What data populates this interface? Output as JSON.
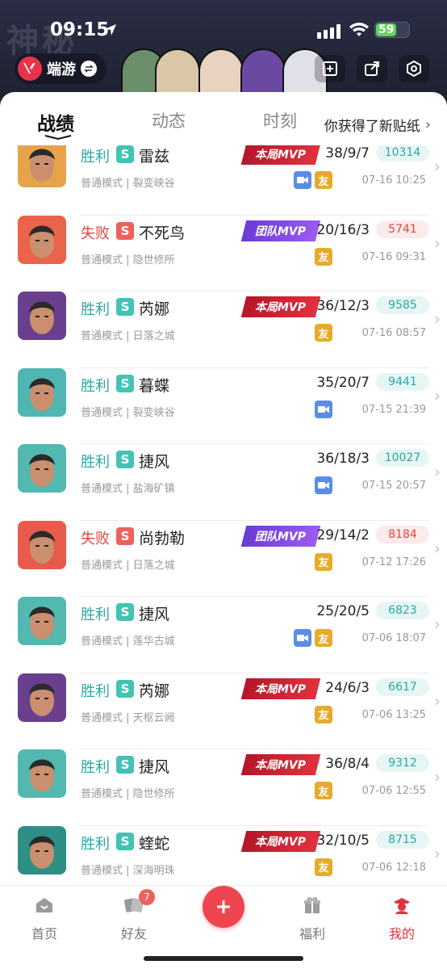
{
  "status_bar": {
    "time": "09:15",
    "battery": "59"
  },
  "header": {
    "app_name": "端游"
  },
  "tabs": [
    {
      "label": "战绩",
      "active": true
    },
    {
      "label": "动态",
      "active": false
    },
    {
      "label": "时刻",
      "active": false
    }
  ],
  "notice": "你获得了新贴纸",
  "records": [
    {
      "result": "胜利",
      "outcome": "win",
      "rank": "S",
      "hero": "雷兹",
      "mode": "普通模式 | 裂变峡谷",
      "mvp": "本局MVP",
      "mvp_type": "match",
      "kda": "38/9/7",
      "score": "10314",
      "video": true,
      "friend": true,
      "datetime": "07-16 10:25",
      "avatar_bg": "#e7a34a"
    },
    {
      "result": "失败",
      "outcome": "lose",
      "rank": "S",
      "hero": "不死鸟",
      "mode": "普通模式 | 隐世修所",
      "mvp": "团队MVP",
      "mvp_type": "team",
      "kda": "20/16/3",
      "score": "5741",
      "video": false,
      "friend": true,
      "datetime": "07-16 09:31",
      "avatar_bg": "#e9644a"
    },
    {
      "result": "胜利",
      "outcome": "win",
      "rank": "S",
      "hero": "芮娜",
      "mode": "普通模式 | 日落之城",
      "mvp": "本局MVP",
      "mvp_type": "match",
      "kda": "36/12/3",
      "score": "9585",
      "video": false,
      "friend": true,
      "datetime": "07-16 08:57",
      "avatar_bg": "#6a3f8e"
    },
    {
      "result": "胜利",
      "outcome": "win",
      "rank": "S",
      "hero": "暮蝶",
      "mode": "普通模式 | 裂变峡谷",
      "mvp": "",
      "mvp_type": "",
      "kda": "35/20/7",
      "score": "9441",
      "video": true,
      "friend": false,
      "datetime": "07-15 21:39",
      "avatar_bg": "#4fb6b2"
    },
    {
      "result": "胜利",
      "outcome": "win",
      "rank": "S",
      "hero": "捷风",
      "mode": "普通模式 | 盐海矿镇",
      "mvp": "",
      "mvp_type": "",
      "kda": "36/18/3",
      "score": "10027",
      "video": true,
      "friend": false,
      "datetime": "07-15 20:57",
      "avatar_bg": "#53b8b0"
    },
    {
      "result": "失败",
      "outcome": "lose",
      "rank": "S",
      "hero": "尚勃勒",
      "mode": "普通模式 | 日落之城",
      "mvp": "团队MVP",
      "mvp_type": "team",
      "kda": "29/14/2",
      "score": "8184",
      "video": false,
      "friend": true,
      "datetime": "07-12 17:26",
      "avatar_bg": "#e85a4c"
    },
    {
      "result": "胜利",
      "outcome": "win",
      "rank": "S",
      "hero": "捷风",
      "mode": "普通模式 | 莲华古城",
      "mvp": "",
      "mvp_type": "",
      "kda": "25/20/5",
      "score": "6823",
      "video": true,
      "friend": true,
      "datetime": "07-06 18:07",
      "avatar_bg": "#53b8b0"
    },
    {
      "result": "胜利",
      "outcome": "win",
      "rank": "S",
      "hero": "芮娜",
      "mode": "普通模式 | 天枢云阙",
      "mvp": "本局MVP",
      "mvp_type": "match",
      "kda": "24/6/3",
      "score": "6617",
      "video": false,
      "friend": true,
      "datetime": "07-06 13:25",
      "avatar_bg": "#6a3f8e"
    },
    {
      "result": "胜利",
      "outcome": "win",
      "rank": "S",
      "hero": "捷风",
      "mode": "普通模式 | 隐世修所",
      "mvp": "本局MVP",
      "mvp_type": "match",
      "kda": "36/8/4",
      "score": "9312",
      "video": false,
      "friend": true,
      "datetime": "07-06 12:55",
      "avatar_bg": "#53b8b0"
    },
    {
      "result": "胜利",
      "outcome": "win",
      "rank": "S",
      "hero": "蝰蛇",
      "mode": "普通模式 | 深海明珠",
      "mvp": "本局MVP",
      "mvp_type": "match",
      "kda": "32/10/5",
      "score": "8715",
      "video": false,
      "friend": true,
      "datetime": "07-06 12:18",
      "avatar_bg": "#2f8f85"
    }
  ],
  "badge_friend_label": "友",
  "bottom_nav": {
    "home": "首页",
    "friends": "好友",
    "friends_badge": "7",
    "welfare": "福利",
    "mine": "我的"
  }
}
